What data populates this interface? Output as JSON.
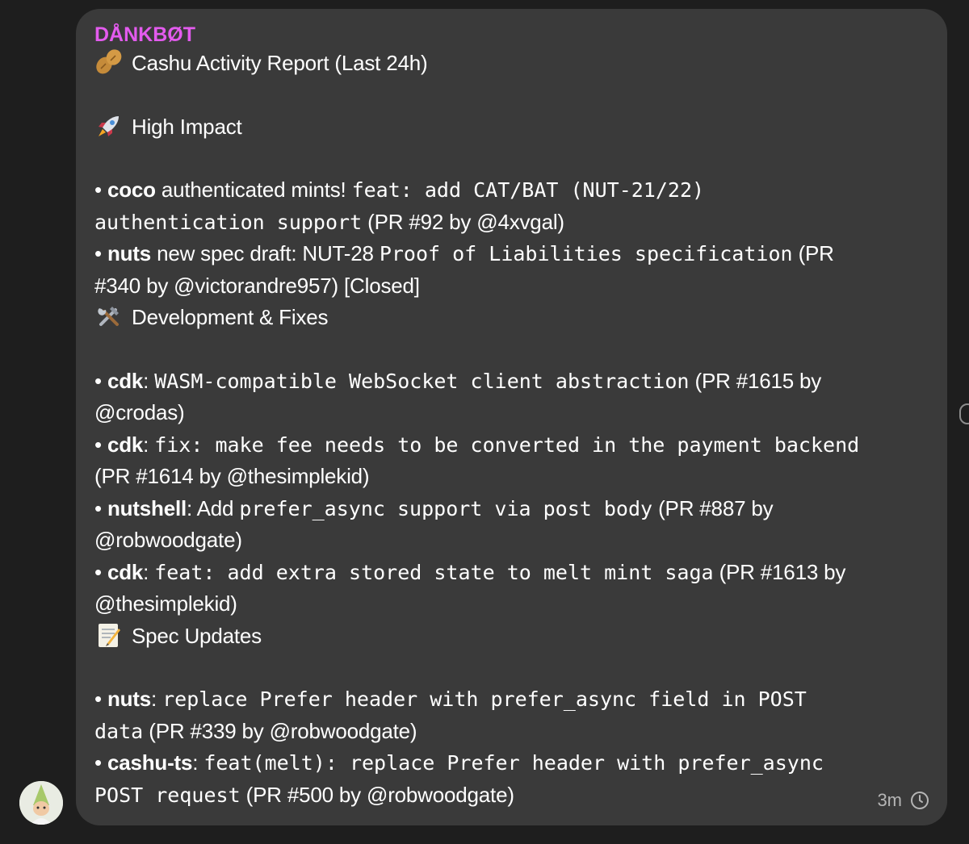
{
  "message": {
    "sender": "DÅNKBØT",
    "title": "Cashu Activity Report (Last 24h)",
    "time": "3m",
    "sections": {
      "high_impact": "High Impact",
      "dev_fixes": "Development & Fixes",
      "spec_updates": "Spec Updates"
    },
    "items": [
      {
        "bullet": "• ",
        "repo": "coco",
        "sep": " ",
        "pre": "authenticated mints! ",
        "code1": "feat: add CAT/BAT (NUT-21/22)",
        "code2": "authentication support",
        "tail": " (PR #92 by @4xvgal)"
      },
      {
        "bullet": "• ",
        "repo": "nuts",
        "sep": " ",
        "pre": "new spec draft: NUT-28 ",
        "code1": "Proof of Liabilities specification",
        "tail1": " (PR",
        "tail2": "#340 by @victorandre957) [Closed]"
      },
      {
        "bullet": "• ",
        "repo": "cdk",
        "sep": ": ",
        "code1": "WASM-compatible WebSocket client abstraction",
        "tail1": " (PR #1615 by",
        "tail2": "@crodas)"
      },
      {
        "bullet": "• ",
        "repo": "cdk",
        "sep": ": ",
        "code1": "fix: make fee needs to be converted in the payment backend",
        "tail2": "(PR #1614 by @thesimplekid)"
      },
      {
        "bullet": "• ",
        "repo": "nutshell",
        "sep": ": ",
        "pre": "Add ",
        "code1": "prefer_async support via post body",
        "tail1": " (PR #887 by",
        "tail2": "@robwoodgate)"
      },
      {
        "bullet": "• ",
        "repo": "cdk",
        "sep": ": ",
        "code1": "feat: add extra stored state to melt mint saga",
        "tail1": " (PR #1613 by",
        "tail2": "@thesimplekid)"
      },
      {
        "bullet": "• ",
        "repo": "nuts",
        "sep": ": ",
        "code1": "replace Prefer header with prefer_async field in POST",
        "code2": "data",
        "tail2": " (PR #339 by @robwoodgate)"
      },
      {
        "bullet": "• ",
        "repo": "cashu-ts",
        "sep": ": ",
        "code1": "feat(melt): replace Prefer header with prefer_async",
        "code2": "POST request",
        "tail2": " (PR #500 by @robwoodgate)"
      }
    ],
    "icons": {
      "title": "peanut-icon",
      "high_impact": "rocket-icon",
      "dev_fixes": "hammer-and-wrench-icon",
      "spec_updates": "memo-icon",
      "time": "clock-icon"
    },
    "colors": {
      "sender": "#e35bee",
      "bubble": "#3a3a3a",
      "background": "#1e1e1e"
    }
  }
}
